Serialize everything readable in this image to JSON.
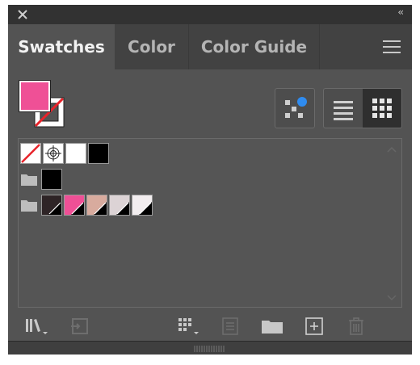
{
  "panel": {
    "tabs": [
      {
        "label": "Swatches",
        "active": true
      },
      {
        "label": "Color",
        "active": false
      },
      {
        "label": "Color Guide",
        "active": false
      }
    ]
  },
  "fill_color": "#ef5096",
  "stroke": "none",
  "colors": {
    "panel_bg": "#535353",
    "tab_bar_bg": "#424242",
    "title_bar_bg": "#323232",
    "accent_blue": "#2f8cf0",
    "none_red": "#e8232a"
  },
  "swatch_rows": [
    {
      "group": false,
      "swatches": [
        {
          "kind": "none"
        },
        {
          "kind": "registration"
        },
        {
          "kind": "color",
          "color": "#ffffff"
        },
        {
          "kind": "color",
          "color": "#000000"
        }
      ]
    },
    {
      "group": true,
      "swatches": [
        {
          "kind": "color",
          "color": "#000000"
        }
      ]
    },
    {
      "group": true,
      "swatches": [
        {
          "kind": "color",
          "color": "#2e2426",
          "spot": true
        },
        {
          "kind": "color",
          "color": "#ef5096",
          "spot": true
        },
        {
          "kind": "color",
          "color": "#d8ab9e",
          "spot": true
        },
        {
          "kind": "color",
          "color": "#dcd3d5",
          "spot": true
        },
        {
          "kind": "color",
          "color": "#f2edef",
          "spot": true
        }
      ]
    }
  ],
  "icons": {
    "close": "close-icon",
    "collapse": "double-chevron-left-icon",
    "menu": "hamburger-menu-icon",
    "show_kinds": "show-swatch-kinds-icon",
    "list_view": "list-view-icon",
    "grid_view": "grid-view-icon",
    "libraries": "swatch-libraries-menu-icon",
    "place": "place-swatches-icon",
    "kinds_menu": "show-swatch-kinds-menu-icon",
    "options": "swatch-options-icon",
    "new_group": "new-color-group-icon",
    "new_swatch": "new-swatch-icon",
    "delete": "trash-icon"
  }
}
